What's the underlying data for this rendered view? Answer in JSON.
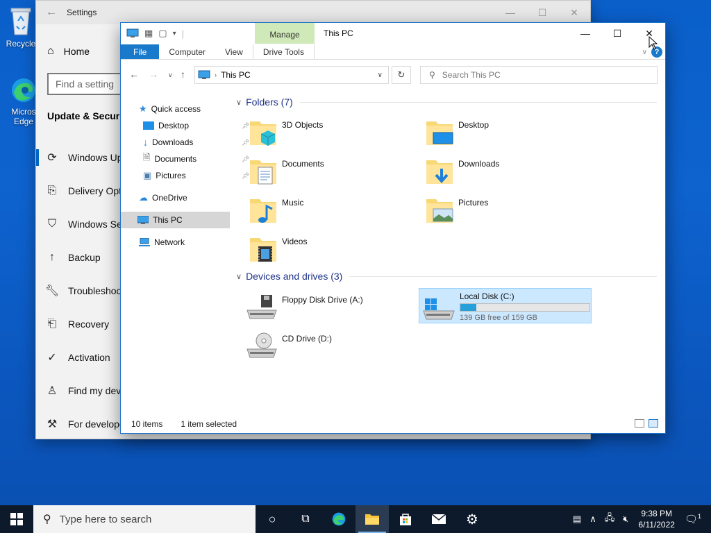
{
  "desktop": {
    "recycle_label": "Recycle",
    "edge_label_1": "Micros",
    "edge_label_2": "Edge"
  },
  "settings": {
    "title": "Settings",
    "home": "Home",
    "search_placeholder": "Find a setting",
    "section": "Update & Securit",
    "nav": [
      {
        "label": "Windows Up",
        "icon": "refresh-icon"
      },
      {
        "label": "Delivery Opt",
        "icon": "delivery-icon"
      },
      {
        "label": "Windows Se",
        "icon": "shield-icon"
      },
      {
        "label": "Backup",
        "icon": "upload-icon"
      },
      {
        "label": "Troubleshoo",
        "icon": "wrench-icon"
      },
      {
        "label": "Recovery",
        "icon": "recovery-icon"
      },
      {
        "label": "Activation",
        "icon": "check-circle-icon"
      },
      {
        "label": "Find my dev",
        "icon": "person-pin-icon"
      },
      {
        "label": "For develope",
        "icon": "tools-icon"
      }
    ]
  },
  "explorer": {
    "window_title": "This PC",
    "context_tab": "Manage",
    "tabs": [
      "File",
      "Computer",
      "View",
      "Drive Tools"
    ],
    "address": "This PC",
    "search_placeholder": "Search This PC",
    "nav_pane": {
      "quick_access": "Quick access",
      "quick_items": [
        "Desktop",
        "Downloads",
        "Documents",
        "Pictures"
      ],
      "onedrive": "OneDrive",
      "this_pc": "This PC",
      "network": "Network"
    },
    "folders_header": "Folders (7)",
    "folders": [
      "3D Objects",
      "Desktop",
      "Documents",
      "Downloads",
      "Music",
      "Pictures",
      "Videos"
    ],
    "devices_header": "Devices and drives (3)",
    "drives": [
      {
        "name": "Floppy Disk Drive (A:)"
      },
      {
        "name": "Local Disk (C:)",
        "free": "139 GB free of 159 GB",
        "used_fraction": 0.126
      },
      {
        "name": "CD Drive (D:)"
      }
    ],
    "status": {
      "items": "10 items",
      "selected": "1 item selected"
    }
  },
  "taskbar": {
    "search_placeholder": "Type here to search",
    "time": "9:38 PM",
    "date": "6/11/2022",
    "notif_count": "1"
  },
  "colors": {
    "accent": "#1979ca",
    "selection": "#cce8ff",
    "drive_bar": "#26a0da",
    "manage_tab": "#cfe9b8"
  }
}
